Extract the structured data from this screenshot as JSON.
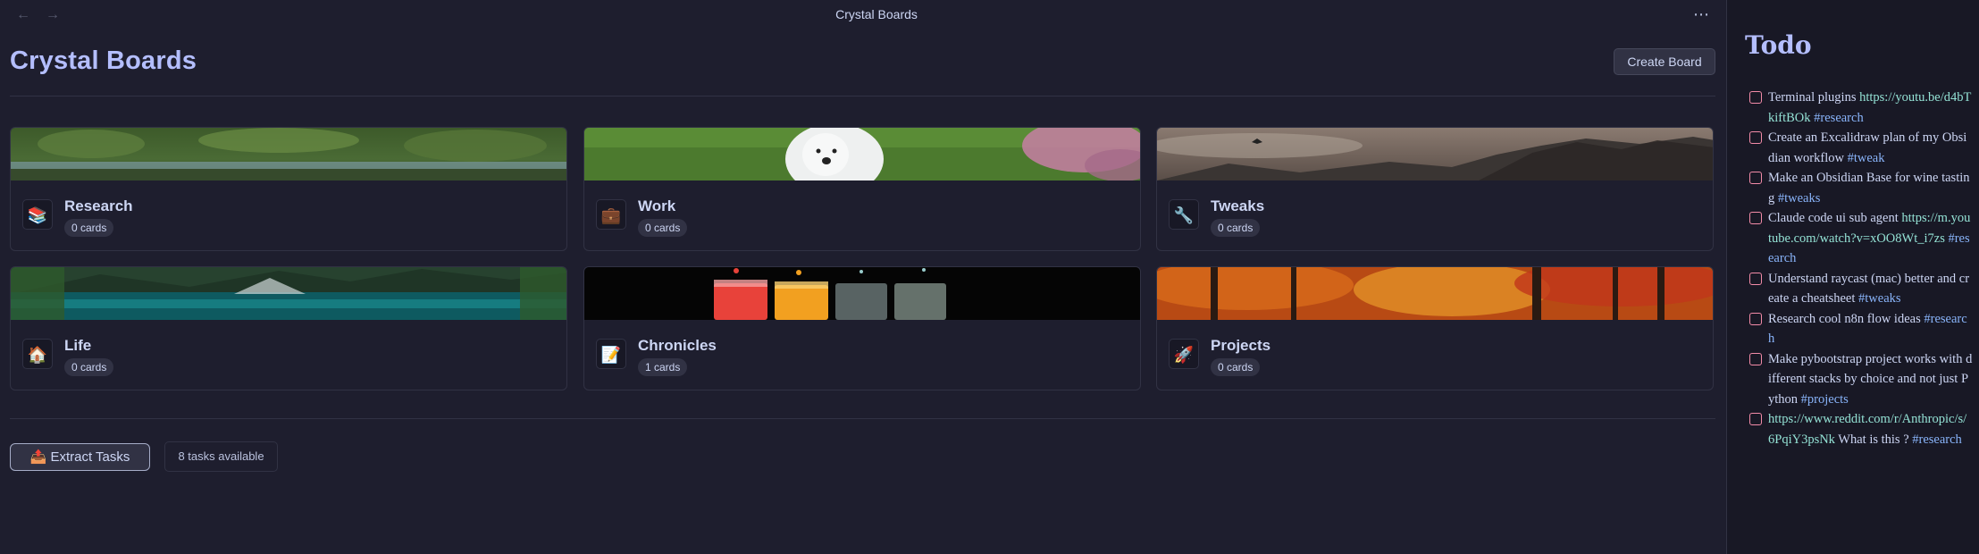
{
  "window": {
    "title": "Crystal Boards"
  },
  "toolbar": {
    "back_icon": "arrow-left-icon",
    "forward_icon": "arrow-right-icon",
    "more_icon": "more-horizontal-icon"
  },
  "page": {
    "title": "Crystal Boards",
    "create_button": "Create Board"
  },
  "boards": [
    {
      "name": "Research",
      "count": "0 cards",
      "icon": "books-icon",
      "glyph": "📚"
    },
    {
      "name": "Work",
      "count": "0 cards",
      "icon": "briefcase-icon",
      "glyph": "💼"
    },
    {
      "name": "Tweaks",
      "count": "0 cards",
      "icon": "wrench-icon",
      "glyph": "🔧"
    },
    {
      "name": "Life",
      "count": "0 cards",
      "icon": "house-icon",
      "glyph": "🏠"
    },
    {
      "name": "Chronicles",
      "count": "1 cards",
      "icon": "memo-icon",
      "glyph": "📝"
    },
    {
      "name": "Projects",
      "count": "0 cards",
      "icon": "rocket-icon",
      "glyph": "🚀"
    }
  ],
  "footer": {
    "extract_button": "📤 Extract Tasks",
    "tasks_available": "8 tasks available"
  },
  "sidebar": {
    "title": "Todo",
    "items": [
      {
        "text": "Terminal plugins ",
        "link": "https://youtu.be/d4bTkiftBOk",
        "tag": "#research"
      },
      {
        "text": "Create an Excalidraw plan of my Obsidian workflow ",
        "link": "",
        "tag": "#tweak"
      },
      {
        "text": "Make  an Obsidian Base for wine tasting  ",
        "link": "",
        "tag": "#tweaks"
      },
      {
        "text": "Claude code ui sub agent ",
        "link": "https://m.youtube.com/watch?v=xOO8Wt_i7zs",
        "tag": "#research"
      },
      {
        "text": "Understand raycast (mac) better and create a cheatsheet ",
        "link": "",
        "tag": "#tweaks"
      },
      {
        "text": "Research cool n8n flow ideas ",
        "link": "",
        "tag": "#research"
      },
      {
        "text": "Make pybootstrap project works with different stacks by choice and not just Python ",
        "link": "",
        "tag": "#projects"
      },
      {
        "text": " What is this ? ",
        "link": "https://www.reddit.com/r/Anthropic/s/6PqiY3psNk",
        "tag": "#research",
        "link_first": true
      }
    ]
  },
  "colors": {
    "accent": "#b4befe",
    "background": "#1e1e2e",
    "sidebar": "#181825",
    "link": "#94e2d5",
    "tag": "#89b4fa",
    "checkbox": "#f38ba8"
  }
}
